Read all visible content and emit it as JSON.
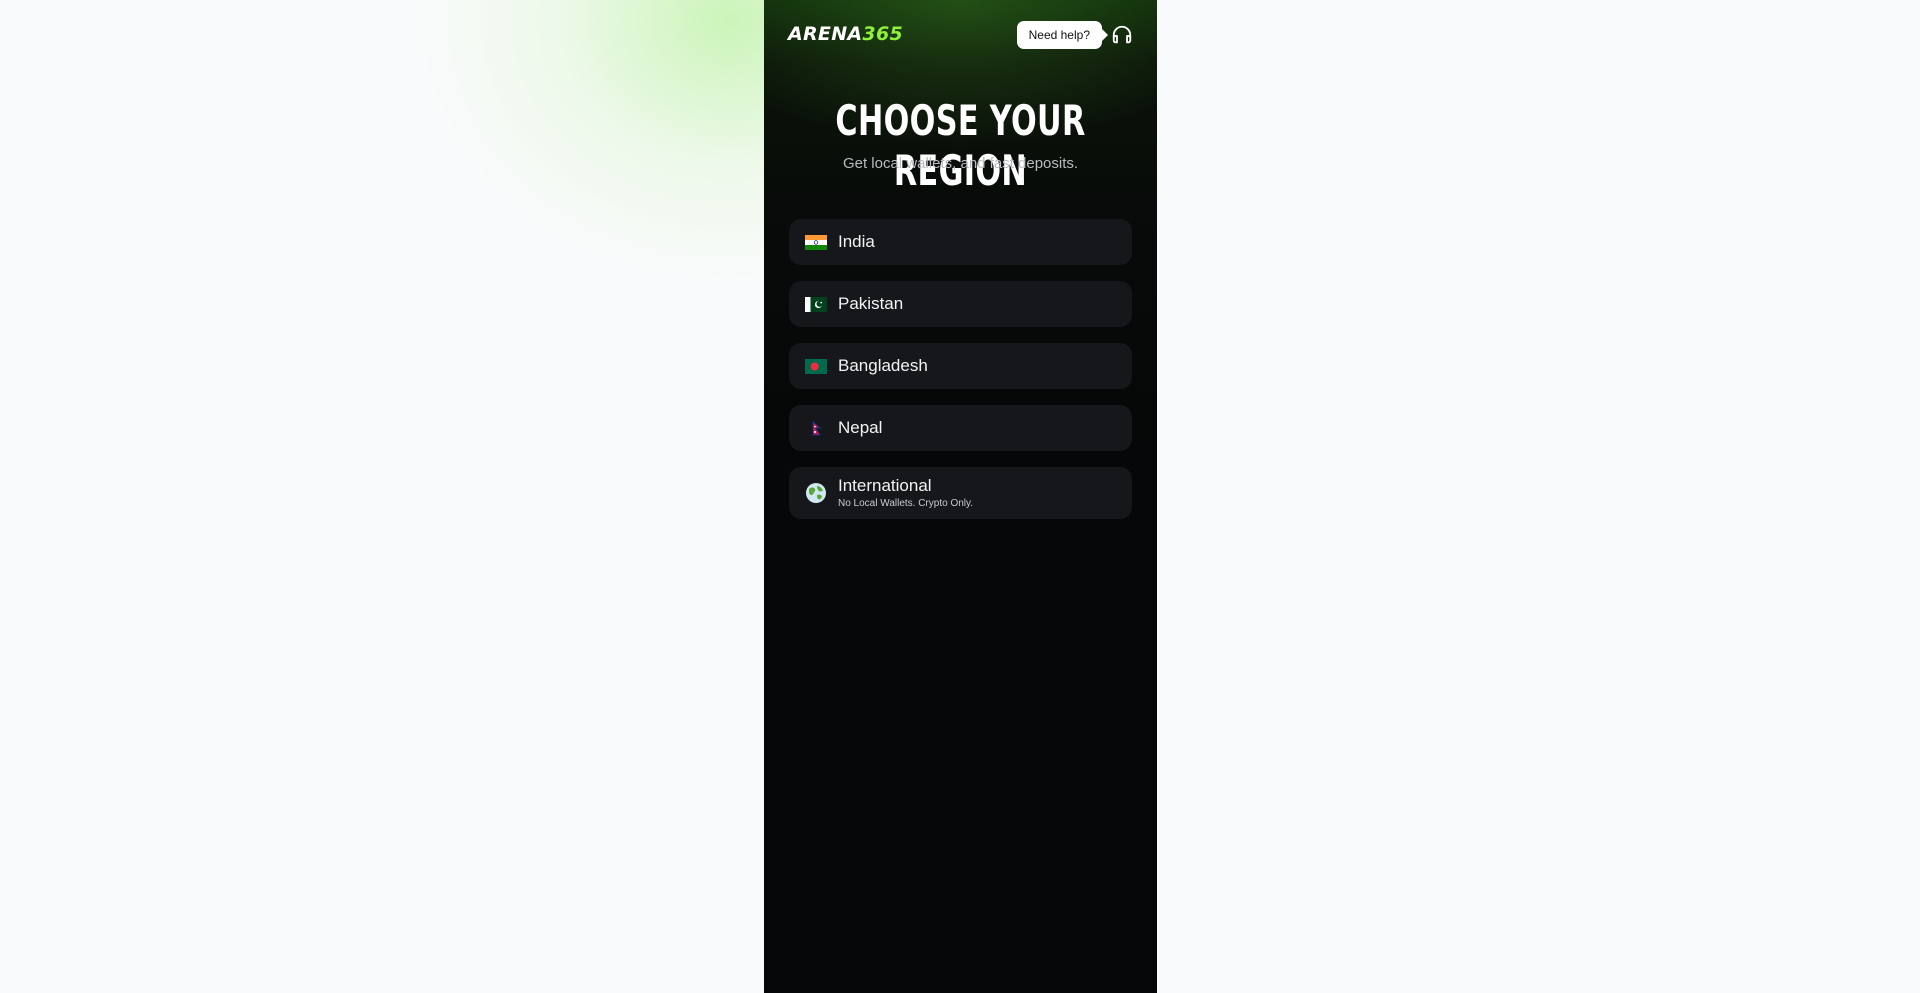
{
  "header": {
    "logo_main": "ARENA",
    "logo_accent": "365",
    "help_label": "Need help?"
  },
  "page": {
    "title": "CHOOSE YOUR REGION",
    "subtitle": "Get local wallets, and fast deposits."
  },
  "regions": [
    {
      "label": "India",
      "flag": "india-flag-icon"
    },
    {
      "label": "Pakistan",
      "flag": "pakistan-flag-icon"
    },
    {
      "label": "Bangladesh",
      "flag": "bangladesh-flag-icon"
    },
    {
      "label": "Nepal",
      "flag": "nepal-flag-icon"
    },
    {
      "label": "International",
      "sub": "No Local Wallets. Crypto Only.",
      "flag": "globe-icon"
    }
  ],
  "colors": {
    "accent": "#8ef03a",
    "card": "#16171a",
    "panel": "#060708"
  }
}
